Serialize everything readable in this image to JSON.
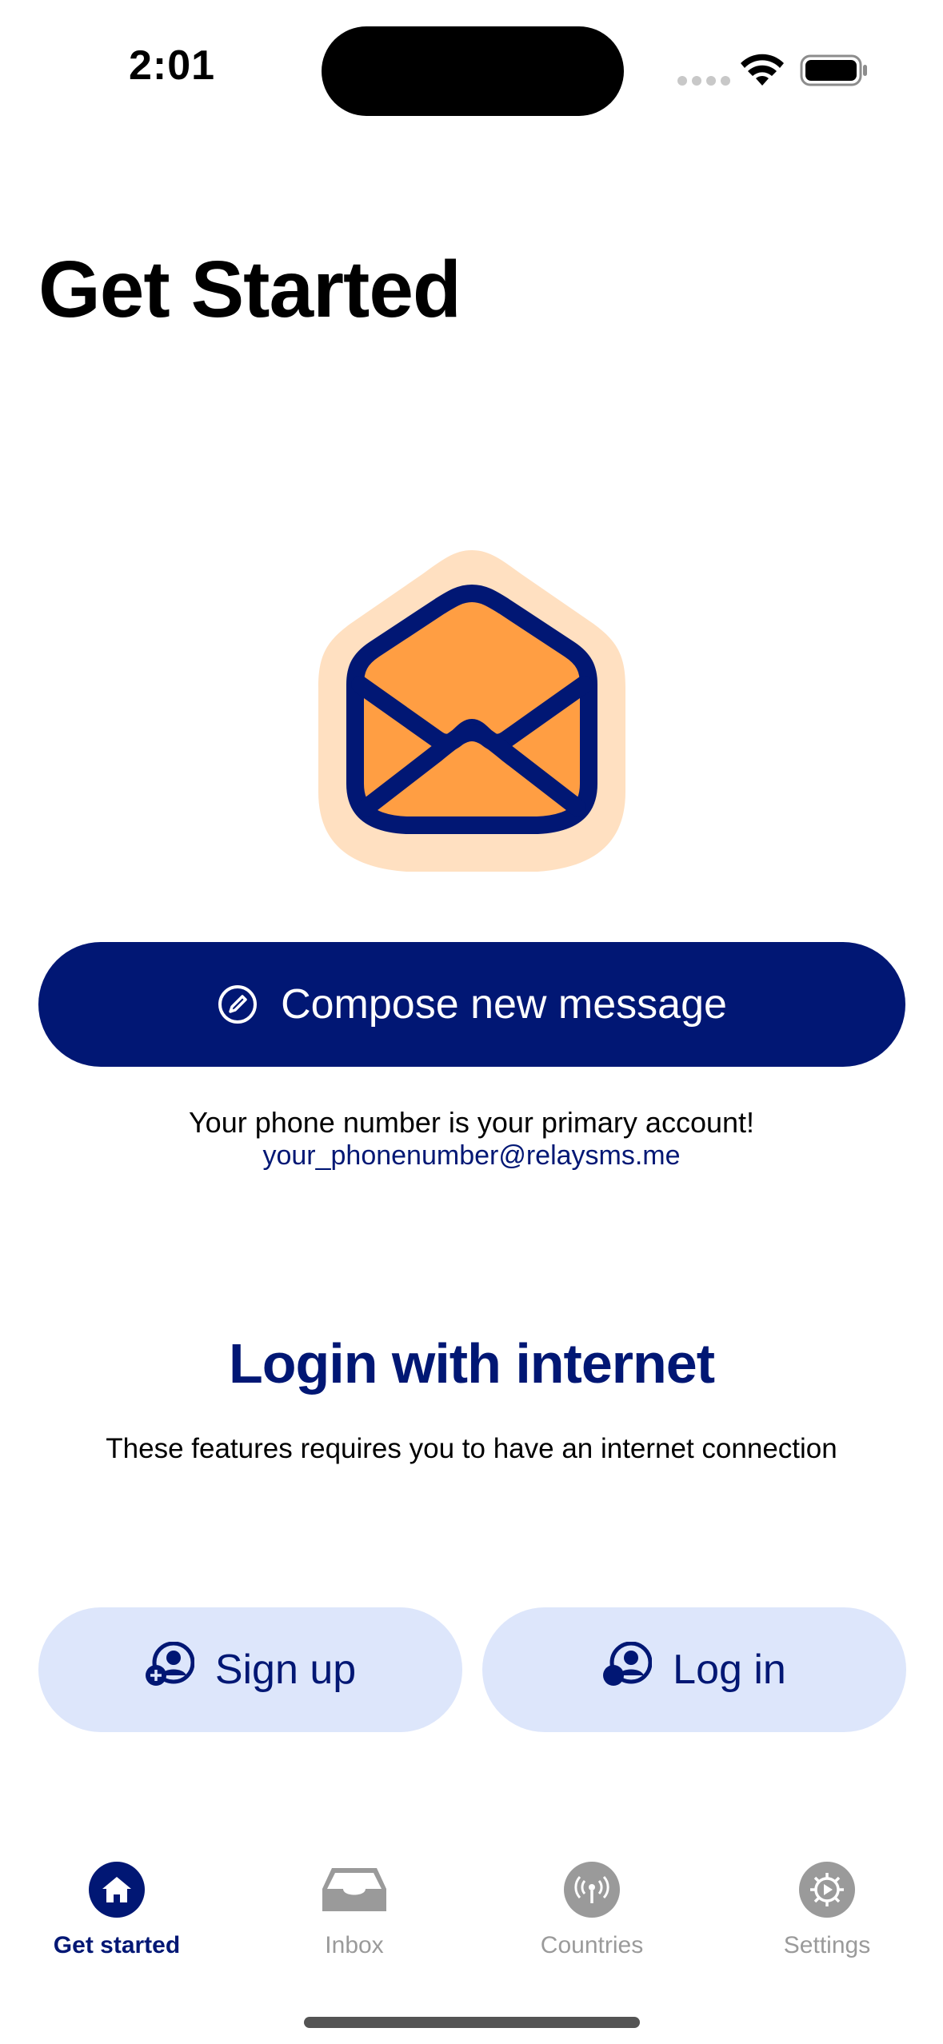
{
  "status_bar": {
    "time": "2:01"
  },
  "page": {
    "title": "Get Started"
  },
  "compose": {
    "label": "Compose new message"
  },
  "primary_account": {
    "note": "Your phone number is your primary account!",
    "email": "your_phonenumber@relaysms.me"
  },
  "login_section": {
    "heading": "Login with internet",
    "subtext": "These features requires you to have an internet connection",
    "signup_label": "Sign up",
    "login_label": "Log in"
  },
  "tab_bar": {
    "items": [
      {
        "label": "Get started",
        "icon": "home-icon",
        "active": true
      },
      {
        "label": "Inbox",
        "icon": "inbox-tray-icon",
        "active": false
      },
      {
        "label": "Countries",
        "icon": "antenna-icon",
        "active": false
      },
      {
        "label": "Settings",
        "icon": "gear-icon",
        "active": false
      }
    ]
  },
  "colors": {
    "brand_navy": "#011774",
    "envelope_orange": "#FF9E43",
    "envelope_halo": "#FFE0C1",
    "pill_background": "#DDE6FB",
    "inactive_gray": "#9A9A9A"
  }
}
